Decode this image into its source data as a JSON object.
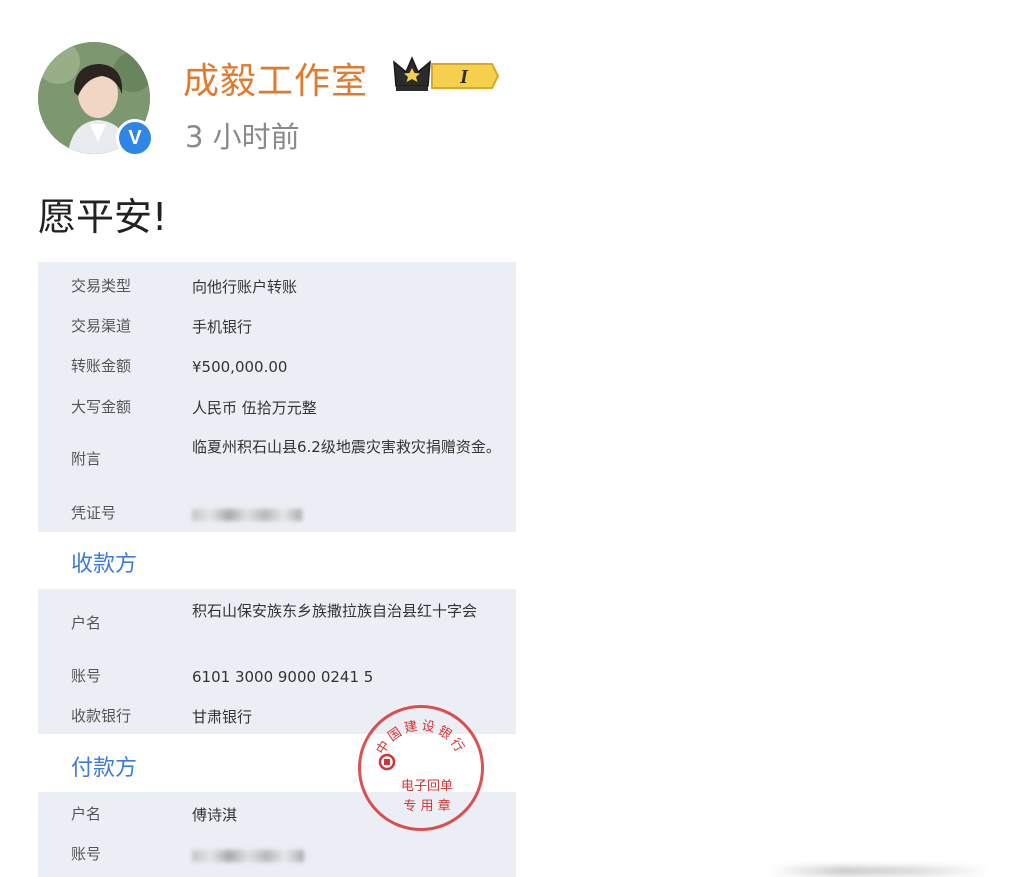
{
  "post": {
    "username": "成毅工作室",
    "badge_label": "I",
    "verified_mark": "V",
    "time": "3 小时前",
    "text": "愿平安!"
  },
  "receipt": {
    "rows_top": [
      {
        "label": "交易类型",
        "value": "向他行账户转账"
      },
      {
        "label": "交易渠道",
        "value": "手机银行"
      },
      {
        "label": "转账金额",
        "value": "¥500,000.00"
      },
      {
        "label": "大写金额",
        "value": "人民币 伍拾万元整"
      },
      {
        "label": "附言",
        "value": "临夏州积石山县6.2级地震灾害救灾捐赠资金。"
      },
      {
        "label": "凭证号",
        "value": ""
      }
    ],
    "payee_title": "收款方",
    "payee_rows": [
      {
        "label": "户名",
        "value": "积石山保安族东乡族撒拉族自治县红十字会"
      },
      {
        "label": "账号",
        "value": "6101 3000 9000 0241 5"
      },
      {
        "label": "收款银行",
        "value": "甘肃银行"
      }
    ],
    "payer_title": "付款方",
    "payer_rows": [
      {
        "label": "户名",
        "value": "傅诗淇"
      },
      {
        "label": "账号",
        "value": ""
      }
    ],
    "seal": {
      "bank": "中国建设银行",
      "line1": "电子回单",
      "line2": "专 用 章"
    }
  },
  "colors": {
    "username": "#e07a2c",
    "accent_blue": "#3d7bd8",
    "receipt_bg": "#ebeef4",
    "seal_red": "#d63232"
  }
}
